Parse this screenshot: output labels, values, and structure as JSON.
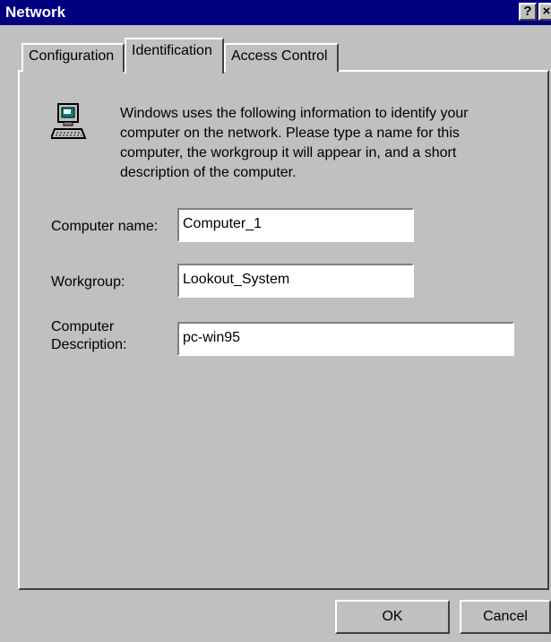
{
  "window": {
    "title": "Network",
    "help_glyph": "?",
    "close_glyph": "×"
  },
  "tabs": [
    {
      "label": "Configuration",
      "selected": false
    },
    {
      "label": "Identification",
      "selected": true
    },
    {
      "label": "Access Control",
      "selected": false
    }
  ],
  "identification": {
    "icon": "computer-icon",
    "description": "Windows uses the following information to identify your computer on the network.  Please type a name for this computer, the workgroup it will appear in, and a short description of the computer.",
    "fields": {
      "computer_name": {
        "label": "Computer name:",
        "value": "Computer_1"
      },
      "workgroup": {
        "label": "Workgroup:",
        "value": "Lookout_System"
      },
      "description": {
        "label_line1": "Computer",
        "label_line2": "Description:",
        "value": "pc-win95"
      }
    }
  },
  "buttons": {
    "ok": "OK",
    "cancel": "Cancel"
  },
  "colors": {
    "titlebar": "#000080",
    "face": "#c0c0c0",
    "field": "#ffffff"
  }
}
